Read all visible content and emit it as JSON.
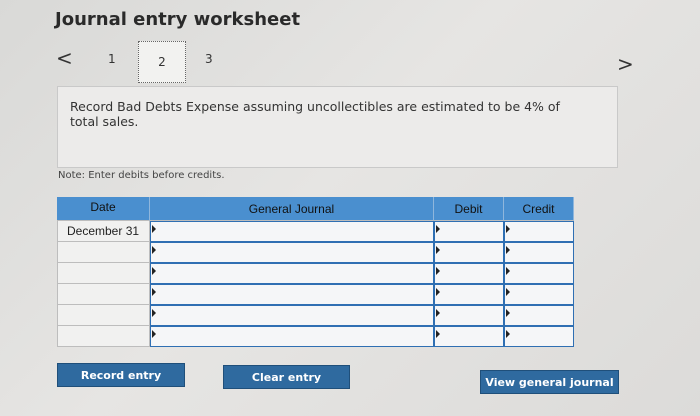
{
  "header": {
    "title": "Journal entry worksheet"
  },
  "pager": {
    "prev_glyph": "<",
    "next_glyph": ">",
    "steps": [
      "1",
      "2",
      "3"
    ],
    "current": "2"
  },
  "instruction": "Record Bad Debts Expense assuming uncollectibles are estimated to be 4% of total sales.",
  "note": "Note: Enter debits before credits.",
  "table": {
    "columns": [
      "Date",
      "General Journal",
      "Debit",
      "Credit"
    ],
    "rows": [
      {
        "date": "December 31",
        "account": "",
        "debit": "",
        "credit": ""
      },
      {
        "date": "",
        "account": "",
        "debit": "",
        "credit": ""
      },
      {
        "date": "",
        "account": "",
        "debit": "",
        "credit": ""
      },
      {
        "date": "",
        "account": "",
        "debit": "",
        "credit": ""
      },
      {
        "date": "",
        "account": "",
        "debit": "",
        "credit": ""
      },
      {
        "date": "",
        "account": "",
        "debit": "",
        "credit": ""
      }
    ]
  },
  "buttons": {
    "record": "Record entry",
    "clear": "Clear entry",
    "view": "View general journal"
  },
  "colors": {
    "header_bg": "#4a8fcf",
    "button_bg": "#2f6a9f",
    "input_border": "#2f6fb3"
  },
  "icons": {
    "prev": "chevron-left-icon",
    "next": "chevron-right-icon",
    "row_marker": "caret-right-icon"
  }
}
